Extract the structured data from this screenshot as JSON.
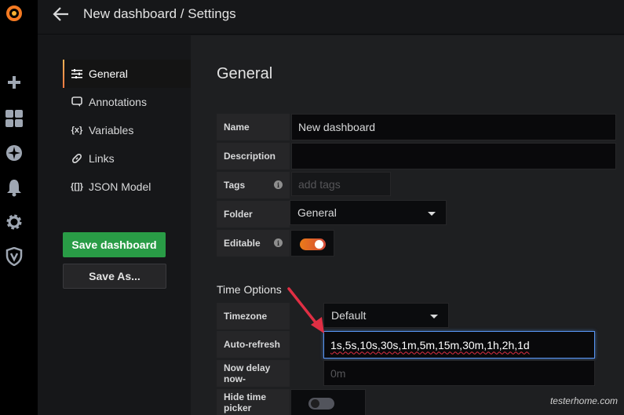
{
  "header": {
    "title": "New dashboard / Settings"
  },
  "sidebar_icons": [
    "grafana-logo-icon",
    "plus-icon",
    "dashboards-icon",
    "explore-icon",
    "bell-icon",
    "gear-icon",
    "shield-icon"
  ],
  "nav": {
    "items": [
      {
        "label": "General",
        "icon": "sliders-icon",
        "active": true
      },
      {
        "label": "Annotations",
        "icon": "comment-icon",
        "active": false
      },
      {
        "label": "Variables",
        "icon": "variable-icon",
        "active": false
      },
      {
        "label": "Links",
        "icon": "link-icon",
        "active": false
      },
      {
        "label": "JSON Model",
        "icon": "json-icon",
        "active": false
      }
    ],
    "icon_glyphs": {
      "variable": "{x}",
      "json": "{[]}"
    },
    "save_button": "Save dashboard",
    "save_as_button": "Save As..."
  },
  "general": {
    "heading": "General",
    "name": {
      "label": "Name",
      "value": "New dashboard"
    },
    "description": {
      "label": "Description",
      "value": ""
    },
    "tags": {
      "label": "Tags",
      "placeholder": "add tags"
    },
    "folder": {
      "label": "Folder",
      "value": "General"
    },
    "editable": {
      "label": "Editable",
      "on": true
    },
    "info_glyph": "i"
  },
  "time_options": {
    "title": "Time Options",
    "timezone": {
      "label": "Timezone",
      "value": "Default"
    },
    "auto_refresh": {
      "label": "Auto-refresh",
      "value": "1s,5s,10s,30s,1m,5m,15m,30m,1h,2h,1d"
    },
    "now_delay": {
      "label": "Now delay now-",
      "placeholder": "0m"
    },
    "hide_time_picker": {
      "label": "Hide time picker",
      "on": false
    }
  },
  "watermark": "testerhome.com",
  "colors": {
    "accent": "#eb7b18",
    "save_green": "#299c46",
    "focus_blue": "#5794f2",
    "arrow_red": "#e02f44"
  }
}
